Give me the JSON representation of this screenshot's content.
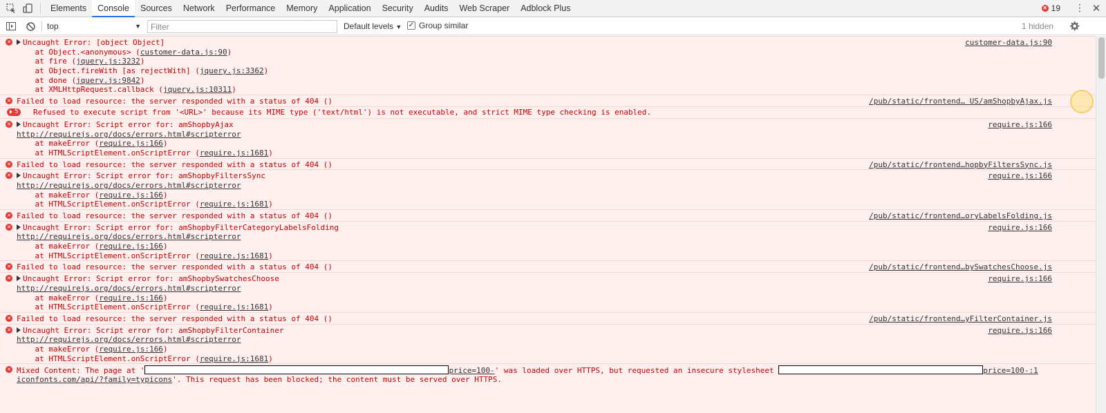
{
  "tabs": [
    "Elements",
    "Console",
    "Sources",
    "Network",
    "Performance",
    "Memory",
    "Application",
    "Security",
    "Audits",
    "Web Scraper",
    "Adblock Plus"
  ],
  "active_tab": "Console",
  "error_count": "19",
  "toolbar": {
    "context": "top",
    "filter_placeholder": "Filter",
    "levels": "Default levels",
    "group_similar": "Group similar",
    "group_checked": true,
    "hidden": "1 hidden"
  },
  "colors": {
    "error_red": "#e53935",
    "row_bg": "#fff0f0",
    "text_red": "#c00000",
    "accent_blue": "#1a73e8"
  },
  "messages": [
    {
      "type": "error-expandable",
      "text": "Uncaught Error: [object Object]",
      "source": "customer-data.js:90",
      "stack": [
        {
          "pre": "    at Object.<anonymous> (",
          "link": "customer-data.js:90",
          "post": ")"
        },
        {
          "pre": "    at fire (",
          "link": "jquery.js:3232",
          "post": ")"
        },
        {
          "pre": "    at Object.fireWith [as rejectWith] (",
          "link": "jquery.js:3362",
          "post": ")"
        },
        {
          "pre": "    at done (",
          "link": "jquery.js:9842",
          "post": ")"
        },
        {
          "pre": "    at XMLHttpRequest.callback (",
          "link": "jquery.js:10311",
          "post": ")"
        }
      ]
    },
    {
      "type": "error",
      "text": "Failed to load resource: the server responded with a status of 404 ()",
      "source": "/pub/static/frontend… US/amShopbyAjax.js"
    },
    {
      "type": "grouped",
      "count": "5",
      "text": "Refused to execute script from '<URL>' because its MIME type ('text/html') is not executable, and strict MIME type checking is enabled."
    },
    {
      "type": "error-expandable",
      "text": "Uncaught Error: Script error for: amShopbyAjax",
      "source": "require.js:166",
      "url": "http://requirejs.org/docs/errors.html#scripterror",
      "stack": [
        {
          "pre": "    at makeError (",
          "link": "require.js:166",
          "post": ")"
        },
        {
          "pre": "    at HTMLScriptElement.onScriptError (",
          "link": "require.js:1681",
          "post": ")"
        }
      ]
    },
    {
      "type": "error",
      "text": "Failed to load resource: the server responded with a status of 404 ()",
      "source": "/pub/static/frontend…hopbyFiltersSync.js"
    },
    {
      "type": "error-expandable",
      "text": "Uncaught Error: Script error for: amShopbyFiltersSync",
      "source": "require.js:166",
      "url": "http://requirejs.org/docs/errors.html#scripterror",
      "stack": [
        {
          "pre": "    at makeError (",
          "link": "require.js:166",
          "post": ")"
        },
        {
          "pre": "    at HTMLScriptElement.onScriptError (",
          "link": "require.js:1681",
          "post": ")"
        }
      ]
    },
    {
      "type": "error",
      "text": "Failed to load resource: the server responded with a status of 404 ()",
      "source": "/pub/static/frontend…oryLabelsFolding.js"
    },
    {
      "type": "error-expandable",
      "text": "Uncaught Error: Script error for: amShopbyFilterCategoryLabelsFolding",
      "source": "require.js:166",
      "url": "http://requirejs.org/docs/errors.html#scripterror",
      "stack": [
        {
          "pre": "    at makeError (",
          "link": "require.js:166",
          "post": ")"
        },
        {
          "pre": "    at HTMLScriptElement.onScriptError (",
          "link": "require.js:1681",
          "post": ")"
        }
      ]
    },
    {
      "type": "error",
      "text": "Failed to load resource: the server responded with a status of 404 ()",
      "source": "/pub/static/frontend…bySwatchesChoose.js"
    },
    {
      "type": "error-expandable",
      "text": "Uncaught Error: Script error for: amShopbySwatchesChoose",
      "source": "require.js:166",
      "url": "http://requirejs.org/docs/errors.html#scripterror",
      "stack": [
        {
          "pre": "    at makeError (",
          "link": "require.js:166",
          "post": ")"
        },
        {
          "pre": "    at HTMLScriptElement.onScriptError (",
          "link": "require.js:1681",
          "post": ")"
        }
      ]
    },
    {
      "type": "error",
      "text": "Failed to load resource: the server responded with a status of 404 ()",
      "source": "/pub/static/frontend…yFilterContainer.js"
    },
    {
      "type": "error-expandable",
      "text": "Uncaught Error: Script error for: amShopbyFilterContainer",
      "source": "require.js:166",
      "url": "http://requirejs.org/docs/errors.html#scripterror",
      "stack": [
        {
          "pre": "    at makeError (",
          "link": "require.js:166",
          "post": ")"
        },
        {
          "pre": "    at HTMLScriptElement.onScriptError (",
          "link": "require.js:1681",
          "post": ")"
        }
      ]
    },
    {
      "type": "mixed",
      "parts": [
        "Mixed Content: The page at '",
        "price=100-",
        "' was loaded over HTTPS, but requested an insecure stylesheet ",
        "price=100-:1"
      ],
      "line2_link": "iconfonts.com/api/?family=typicons",
      "line2_rest": "'. This request has been blocked; the content must be served over HTTPS."
    }
  ]
}
